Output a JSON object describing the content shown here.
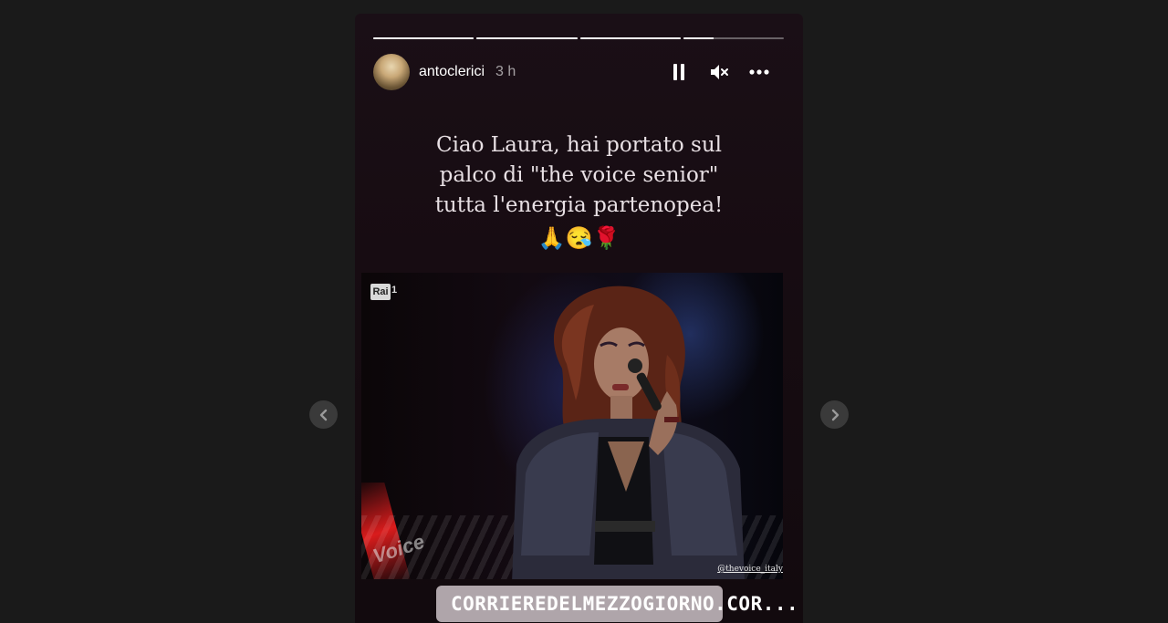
{
  "story": {
    "username": "antoclerici",
    "time_ago": "3 h",
    "progress_segments": [
      1,
      1,
      1,
      0.3
    ],
    "caption_lines": [
      "Ciao Laura, hai portato sul",
      "palco di \"the voice senior\"",
      "tutta l'energia partenopea!"
    ],
    "caption_emojis": "🙏😪🌹",
    "media": {
      "channel_logo": "Rai",
      "channel_number": "1",
      "show_logo": "Voice",
      "watermark": "@thevoice_italy"
    },
    "link_sticker": {
      "icon": "link-icon",
      "text": "CORRIEREDELMEZZOGIORNO.COR..."
    }
  },
  "controls": {
    "pause_icon": "pause-icon",
    "mute_icon": "muted-speaker-icon",
    "more_icon": "more-options-icon"
  },
  "navigation": {
    "prev_icon": "chevron-left-icon",
    "next_icon": "chevron-right-icon"
  },
  "colors": {
    "page_bg": "#1a1a1a",
    "story_bg": "#170c12",
    "text": "#ffffff",
    "nav_button": "#3a3a3a"
  }
}
